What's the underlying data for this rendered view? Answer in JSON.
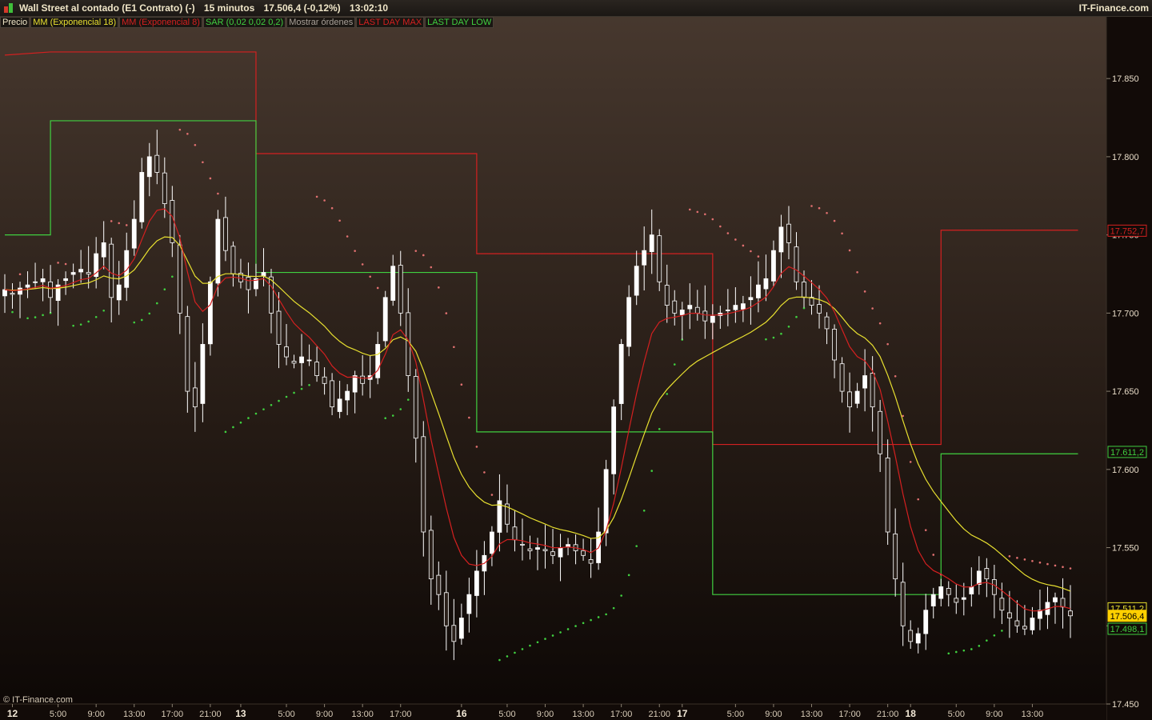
{
  "header": {
    "instrument": "Wall Street al contado (E1 Contrato) (-)",
    "timeframe": "15 minutos",
    "last_quote": "17.506,4 (-0,12%)",
    "clock": "13:02:10",
    "brand": "IT-Finance.com"
  },
  "legend": [
    {
      "label": "Precio",
      "color": "#f0e6c8"
    },
    {
      "label": "MM (Exponencial 18)",
      "color": "#e8e030"
    },
    {
      "label": "MM (Exponencial 8)",
      "color": "#d42020"
    },
    {
      "label": "SAR (0,02 0,02 0,2)",
      "color": "#40d040"
    },
    {
      "label": "Mostrar órdenes",
      "color": "#a8a098"
    },
    {
      "label": "LAST DAY MAX",
      "color": "#d42020"
    },
    {
      "label": "LAST DAY LOW",
      "color": "#40d040"
    }
  ],
  "copyright": "© IT-Finance.com",
  "colors": {
    "background_top": "#48392f",
    "background_bottom": "#0c0705",
    "candles": "#ffffff",
    "ema18": "#e8e030",
    "ema8": "#d42020",
    "sar_up": "#40d040",
    "sar_down": "#e07070",
    "day_max": "#d42020",
    "day_low": "#40d040"
  },
  "chart_data": {
    "type": "line",
    "title": "Wall Street al contado (E1 Contrato) (-)",
    "ylim": [
      17450,
      17890
    ],
    "y_ticks": [
      17450,
      17500,
      17550,
      17600,
      17650,
      17700,
      17750,
      17800,
      17850
    ],
    "y_tick_labels": [
      "17.450",
      "17.500",
      "17.550",
      "17.600",
      "17.650",
      "17.700",
      "17.750",
      "17.800",
      "17.850"
    ],
    "x_ticks": [
      {
        "i": 1,
        "label": "12",
        "bold": true
      },
      {
        "i": 7,
        "label": "5:00"
      },
      {
        "i": 12,
        "label": "9:00"
      },
      {
        "i": 17,
        "label": "13:00"
      },
      {
        "i": 22,
        "label": "17:00"
      },
      {
        "i": 27,
        "label": "21:00"
      },
      {
        "i": 31,
        "label": "13",
        "bold": true
      },
      {
        "i": 37,
        "label": "5:00"
      },
      {
        "i": 42,
        "label": "9:00"
      },
      {
        "i": 47,
        "label": "13:00"
      },
      {
        "i": 52,
        "label": "17:00"
      },
      {
        "i": 60,
        "label": "16",
        "bold": true
      },
      {
        "i": 66,
        "label": "5:00"
      },
      {
        "i": 71,
        "label": "9:00"
      },
      {
        "i": 76,
        "label": "13:00"
      },
      {
        "i": 81,
        "label": "17:00"
      },
      {
        "i": 86,
        "label": "21:00"
      },
      {
        "i": 89,
        "label": "17",
        "bold": true
      },
      {
        "i": 96,
        "label": "5:00"
      },
      {
        "i": 101,
        "label": "9:00"
      },
      {
        "i": 106,
        "label": "13:00"
      },
      {
        "i": 111,
        "label": "17:00"
      },
      {
        "i": 116,
        "label": "21:00"
      },
      {
        "i": 119,
        "label": "18",
        "bold": true
      },
      {
        "i": 125,
        "label": "5:00"
      },
      {
        "i": 130,
        "label": "9:00"
      },
      {
        "i": 135,
        "label": "13:00"
      }
    ],
    "series": [
      {
        "name": "Precio",
        "values": [
          17715,
          17712,
          17716,
          17718,
          17720,
          17722,
          17710,
          17718,
          17722,
          17726,
          17728,
          17725,
          17738,
          17745,
          17710,
          17718,
          17740,
          17760,
          17790,
          17800,
          17790,
          17770,
          17745,
          17700,
          17650,
          17640,
          17680,
          17720,
          17760,
          17740,
          17725,
          17720,
          17715,
          17722,
          17726,
          17700,
          17680,
          17672,
          17668,
          17672,
          17670,
          17660,
          17655,
          17640,
          17645,
          17650,
          17660,
          17655,
          17660,
          17680,
          17710,
          17730,
          17700,
          17660,
          17620,
          17560,
          17530,
          17520,
          17500,
          17490,
          17505,
          17520,
          17535,
          17545,
          17560,
          17580,
          17565,
          17555,
          17552,
          17548,
          17550,
          17548,
          17545,
          17550,
          17552,
          17548,
          17545,
          17540,
          17560,
          17600,
          17640,
          17680,
          17710,
          17730,
          17740,
          17750,
          17720,
          17705,
          17700,
          17702,
          17705,
          17700,
          17695,
          17698,
          17700,
          17702,
          17705,
          17706,
          17710,
          17718,
          17722,
          17740,
          17755,
          17745,
          17720,
          17710,
          17705,
          17700,
          17690,
          17670,
          17650,
          17640,
          17650,
          17660,
          17640,
          17610,
          17560,
          17530,
          17500,
          17490,
          17495,
          17510,
          17520,
          17525,
          17520,
          17515,
          17518,
          17525,
          17535,
          17530,
          17520,
          17510,
          17505,
          17500,
          17498,
          17505,
          17510,
          17515,
          17518,
          17512,
          17506.4
        ]
      },
      {
        "name": "MM (Exponencial 18)",
        "values": []
      },
      {
        "name": "MM (Exponencial 8)",
        "values": []
      },
      {
        "name": "SAR (0,02 0,02 0,2)",
        "values": []
      },
      {
        "name": "LAST DAY MAX",
        "steps": [
          [
            0,
            17865
          ],
          [
            6,
            17867
          ],
          [
            33,
            17867
          ],
          [
            33,
            17802
          ],
          [
            62,
            17802
          ],
          [
            62,
            17738
          ],
          [
            93,
            17738
          ],
          [
            93,
            17616
          ],
          [
            123,
            17616
          ],
          [
            123,
            17753
          ],
          [
            141,
            17753
          ]
        ]
      },
      {
        "name": "LAST DAY LOW",
        "steps": [
          [
            0,
            17750
          ],
          [
            6,
            17750
          ],
          [
            6,
            17823
          ],
          [
            33,
            17823
          ],
          [
            33,
            17726
          ],
          [
            62,
            17726
          ],
          [
            62,
            17624
          ],
          [
            93,
            17624
          ],
          [
            93,
            17520
          ],
          [
            123,
            17520
          ],
          [
            123,
            17610
          ],
          [
            141,
            17610
          ]
        ]
      }
    ],
    "price_labels": [
      {
        "value": 17752.7,
        "label": "17.752,7",
        "color": "#d42020"
      },
      {
        "value": 17611.2,
        "label": "17.611,2",
        "color": "#40d040"
      },
      {
        "value": 17511.2,
        "label": "17.511,2",
        "color": "#e8e030"
      },
      {
        "value": 17506.4,
        "label": "17.506,4",
        "color": "#ffd000",
        "filled": true
      },
      {
        "value": 17498.1,
        "label": "17.498,1",
        "color": "#40d040"
      }
    ]
  }
}
